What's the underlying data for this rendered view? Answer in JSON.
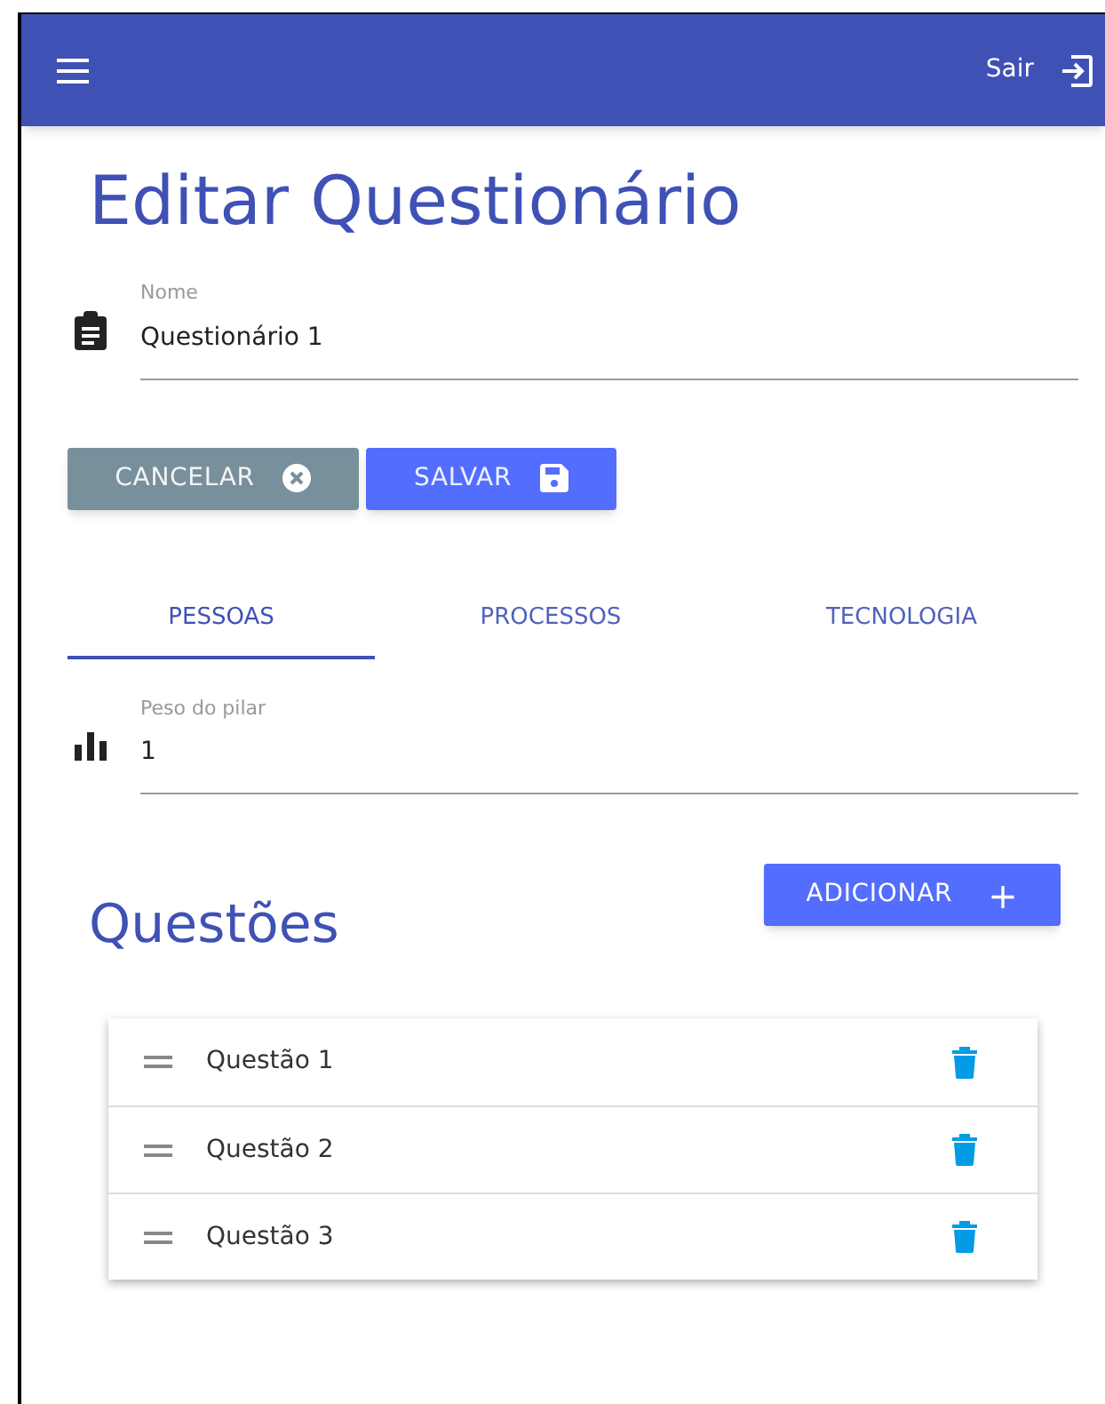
{
  "app_bar": {
    "logout_label": "Sair"
  },
  "title": "Editar Questionário",
  "name_field": {
    "label": "Nome",
    "value": "Questionário 1"
  },
  "buttons": [
    {
      "label": "CANCELAR",
      "kind": "cancel"
    },
    {
      "label": "SALVAR",
      "kind": "save"
    }
  ],
  "tabs": [
    {
      "label": "PESSOAS",
      "selected": true
    },
    {
      "label": "PROCESSOS",
      "selected": false
    },
    {
      "label": "TECNOLOGIA",
      "selected": false
    }
  ],
  "weight_field": {
    "label": "Peso do pilar",
    "value": "1"
  },
  "questions_heading": "Questões",
  "add_button": {
    "label": "ADICIONAR",
    "icon": "+"
  },
  "questions": [
    {
      "label": "Questão 1"
    },
    {
      "label": "Questão 2"
    },
    {
      "label": "Questão 3"
    }
  ]
}
